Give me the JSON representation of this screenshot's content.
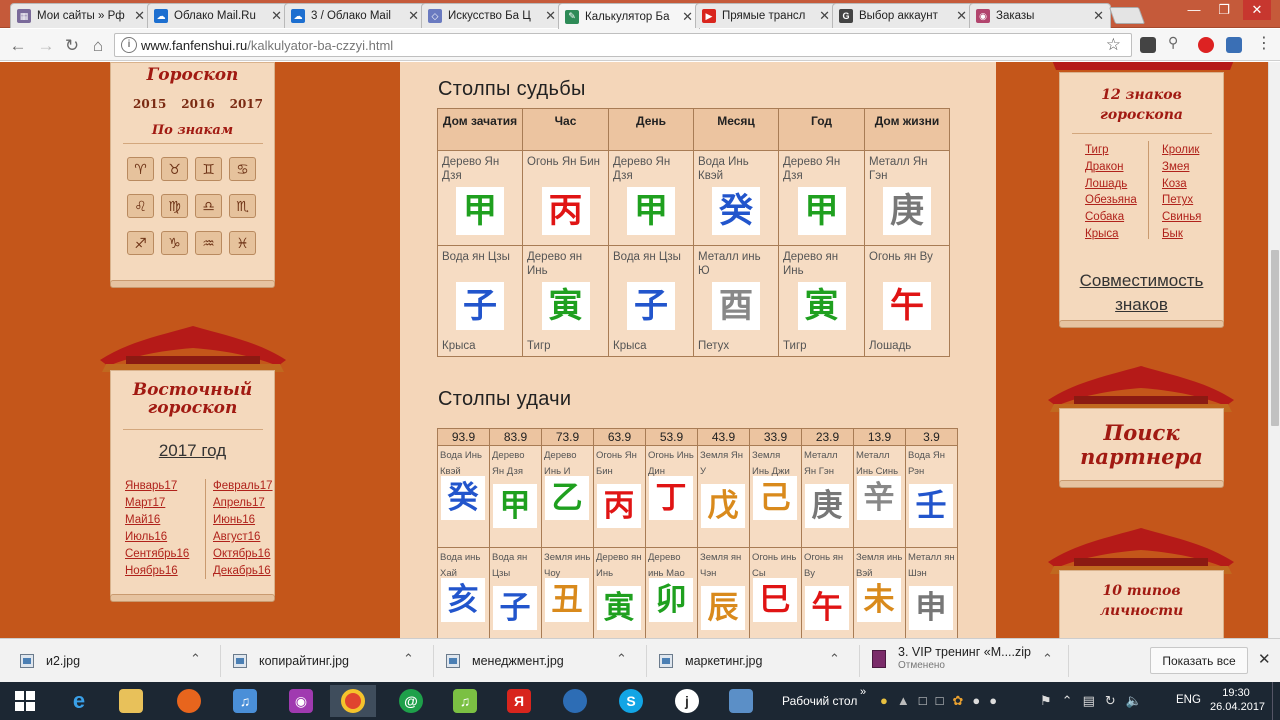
{
  "browser": {
    "tabs": [
      {
        "title": "Мои сайты » Рф",
        "color": "#7a6a9a",
        "glyph": "▦"
      },
      {
        "title": "Облако Mail.Ru",
        "color": "#1d6fd0",
        "glyph": "☁"
      },
      {
        "title": "3 / Облако Mail",
        "color": "#1d6fd0",
        "glyph": "☁"
      },
      {
        "title": "Искусство Ба Ц",
        "color": "#6a7ac0",
        "glyph": "◇"
      },
      {
        "title": "Калькулятор Ба",
        "color": "#2e8b57",
        "glyph": "✎"
      },
      {
        "title": "Прямые трансл",
        "color": "#d9251d",
        "glyph": "▶"
      },
      {
        "title": "Выбор аккаунт",
        "color": "#444444",
        "glyph": "G"
      },
      {
        "title": "Заказы",
        "color": "#b2456e",
        "glyph": "◉"
      }
    ],
    "address": {
      "host": "www.fanfenshui.ru",
      "path": "/kalkulyator-ba-czzyi.html"
    }
  },
  "left": {
    "horoscope_title": "Гороскоп",
    "years": [
      "2015",
      "2016",
      "2017"
    ],
    "by_signs": "По знакам",
    "eastern_title": "Восточный гороскоп",
    "year_link": "2017 год",
    "months_left": [
      "Январь17",
      "Март17",
      "Май16",
      "Июль16",
      "Сентябрь16",
      "Ноябрь16"
    ],
    "months_right": [
      "Февраль17",
      "Апрель17",
      "Июнь16",
      "Август16",
      "Октябрь16",
      "Декабрь16"
    ]
  },
  "right": {
    "signs_title": "12 знаков гороскопа",
    "signs_left": [
      "Тигр",
      "Дракон",
      "Лошадь",
      "Обезьяна",
      "Собака",
      "Крыса"
    ],
    "signs_right": [
      "Кролик",
      "Змея",
      "Коза",
      "Петух",
      "Свинья",
      "Бык"
    ],
    "compat": "Совместимость знаков",
    "partner": "Поиск партнера",
    "types": "10 типов личности"
  },
  "destiny": {
    "title": "Столпы судьбы",
    "headers": [
      "Дом зачатия",
      "Час",
      "День",
      "Месяц",
      "Год",
      "Дом жизни"
    ],
    "stems": [
      {
        "label": "Дерево Ян Дзя",
        "hz": "甲",
        "color": "#1fa01f"
      },
      {
        "label": "Огонь Ян Бин",
        "hz": "丙",
        "color": "#e01414"
      },
      {
        "label": "Дерево Ян Дзя",
        "hz": "甲",
        "color": "#1fa01f"
      },
      {
        "label": "Вода Инь Квэй",
        "hz": "癸",
        "color": "#2255cc"
      },
      {
        "label": "Дерево Ян Дзя",
        "hz": "甲",
        "color": "#1fa01f"
      },
      {
        "label": "Металл Ян Гэн",
        "hz": "庚",
        "color": "#777777"
      }
    ],
    "branches": [
      {
        "label": "Вода ян Цзы",
        "hz": "子",
        "color": "#2255cc",
        "animal": "Крыса"
      },
      {
        "label": "Дерево ян Инь",
        "hz": "寅",
        "color": "#1fa01f",
        "animal": "Тигр"
      },
      {
        "label": "Вода ян Цзы",
        "hz": "子",
        "color": "#2255cc",
        "animal": "Крыса"
      },
      {
        "label": "Металл инь Ю",
        "hz": "酉",
        "color": "#888888",
        "animal": "Петух"
      },
      {
        "label": "Дерево ян Инь",
        "hz": "寅",
        "color": "#1fa01f",
        "animal": "Тигр"
      },
      {
        "label": "Огонь ян Ву",
        "hz": "午",
        "color": "#e01414",
        "animal": "Лошадь"
      }
    ]
  },
  "luck": {
    "title": "Столпы удачи",
    "ages": [
      "93.9",
      "83.9",
      "73.9",
      "63.9",
      "53.9",
      "43.9",
      "33.9",
      "23.9",
      "13.9",
      "3.9"
    ],
    "stems": [
      {
        "label": "Вода Инь Квэй",
        "hz": "癸",
        "color": "#2255cc"
      },
      {
        "label": "Дерево Ян Дзя",
        "hz": "甲",
        "color": "#1fa01f"
      },
      {
        "label": "Дерево Инь И",
        "hz": "乙",
        "color": "#1fa01f"
      },
      {
        "label": "Огонь Ян Бин",
        "hz": "丙",
        "color": "#e01414"
      },
      {
        "label": "Огонь Инь Дин",
        "hz": "丁",
        "color": "#e01414"
      },
      {
        "label": "Земля Ян У",
        "hz": "戊",
        "color": "#d98a1c"
      },
      {
        "label": "Земля Инь Джи",
        "hz": "己",
        "color": "#d98a1c"
      },
      {
        "label": "Металл Ян Гэн",
        "hz": "庚",
        "color": "#777777"
      },
      {
        "label": "Металл Инь Синь",
        "hz": "辛",
        "color": "#888888"
      },
      {
        "label": "Вода Ян Рэн",
        "hz": "壬",
        "color": "#2255cc"
      }
    ],
    "branches": [
      {
        "label": "Вода инь Хай",
        "hz": "亥",
        "color": "#2255cc"
      },
      {
        "label": "Вода ян Цзы",
        "hz": "子",
        "color": "#2255cc"
      },
      {
        "label": "Земля инь Чоу",
        "hz": "丑",
        "color": "#d98a1c"
      },
      {
        "label": "Дерево ян Инь",
        "hz": "寅",
        "color": "#1fa01f"
      },
      {
        "label": "Дерево инь Мао",
        "hz": "卯",
        "color": "#1fa01f"
      },
      {
        "label": "Земля ян Чэн",
        "hz": "辰",
        "color": "#d98a1c"
      },
      {
        "label": "Огонь инь Сы",
        "hz": "巳",
        "color": "#e01414"
      },
      {
        "label": "Огонь ян Ву",
        "hz": "午",
        "color": "#e01414"
      },
      {
        "label": "Земля инь Вэй",
        "hz": "未",
        "color": "#d98a1c"
      },
      {
        "label": "Металл ян Шэн",
        "hz": "申",
        "color": "#777777"
      }
    ]
  },
  "downloads": {
    "items": [
      "и2.jpg",
      "копирайтинг.jpg",
      "менеджмент.jpg",
      "маркетинг.jpg"
    ],
    "zip_name": "3. VIP тренинг «М....zip",
    "zip_status": "Отменено",
    "show_all": "Показать все"
  },
  "taskbar": {
    "desktop_label": "Рабочий стол",
    "lang": "ENG",
    "time": "19:30",
    "date": "26.04.2017"
  }
}
